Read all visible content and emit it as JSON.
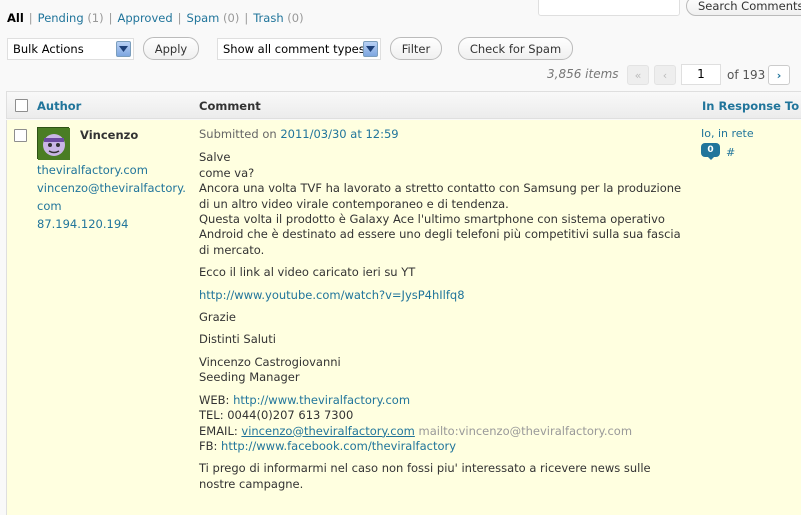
{
  "filters": [
    {
      "label": "All",
      "count": ""
    },
    {
      "label": "Pending",
      "count": "(1)"
    },
    {
      "label": "Approved",
      "count": ""
    },
    {
      "label": "Spam",
      "count": "(0)"
    },
    {
      "label": "Trash",
      "count": "(0)"
    }
  ],
  "search": {
    "button_label": "Search Comments",
    "value": ""
  },
  "toolbar": {
    "bulk_actions": "Bulk Actions",
    "apply": "Apply",
    "comment_types": "Show all comment types",
    "filter": "Filter",
    "check_spam": "Check for Spam"
  },
  "pagination": {
    "items": "3,856 items",
    "first": "«",
    "prev": "‹",
    "current_page": "1",
    "of_pages": "of 193",
    "next": "›"
  },
  "table": {
    "headers": {
      "author": "Author",
      "comment": "Comment",
      "response": "In Response To"
    }
  },
  "comment": {
    "author_name": "Vincenzo",
    "author_url": "theviralfactory.com",
    "author_email_1": "vincenzo@theviralfactory.",
    "author_email_2": "com",
    "author_ip": "87.194.120.194",
    "submitted_prefix": "Submitted on ",
    "submitted_date": "2011/03/30 at 12:59",
    "line_salve": "Salve",
    "line_come": "come va?",
    "para1_line1": "Ancora una volta TVF ha lavorato a stretto contatto con Samsung per la produzione",
    "para1_line2": "di un altro video virale contemporaneo e di tendenza.",
    "para1_line3": "Questa volta il prodotto è Galaxy Ace l'ultimo smartphone con sistema operativo",
    "para1_line4": "Android che è destinato ad essere uno degli telefoni più competitivi sulla sua fascia",
    "para1_line5": "di mercato.",
    "ecco": "Ecco il link al video caricato ieri su YT",
    "youtube_link": "http://www.youtube.com/watch?v=JysP4hIlfq8",
    "grazie": "Grazie",
    "distinti": "Distinti Saluti",
    "sig_name": "Vincenzo Castrogiovanni",
    "sig_role": "Seeding Manager",
    "web_label": "WEB: ",
    "web_link": "http://www.theviralfactory.com",
    "tel": "TEL: 0044(0)207 613 7300",
    "email_label": "EMAIL: ",
    "email_link": "vincenzo@theviralfactory.com",
    "mailto": " mailto:vincenzo@theviralfactory.com",
    "fb_label": "FB: ",
    "fb_link": "http://www.facebook.com/theviralfactory",
    "closing_line1": "Ti prego di informarmi nel caso non fossi piu' interessato a ricevere news sulle",
    "closing_line2": "nostre campagne."
  },
  "response": {
    "post_title": "Io, in rete",
    "bubble_count": "0",
    "hash": "#"
  },
  "colors": {
    "link": "#21759b",
    "row_highlight": "#ffffe0"
  }
}
